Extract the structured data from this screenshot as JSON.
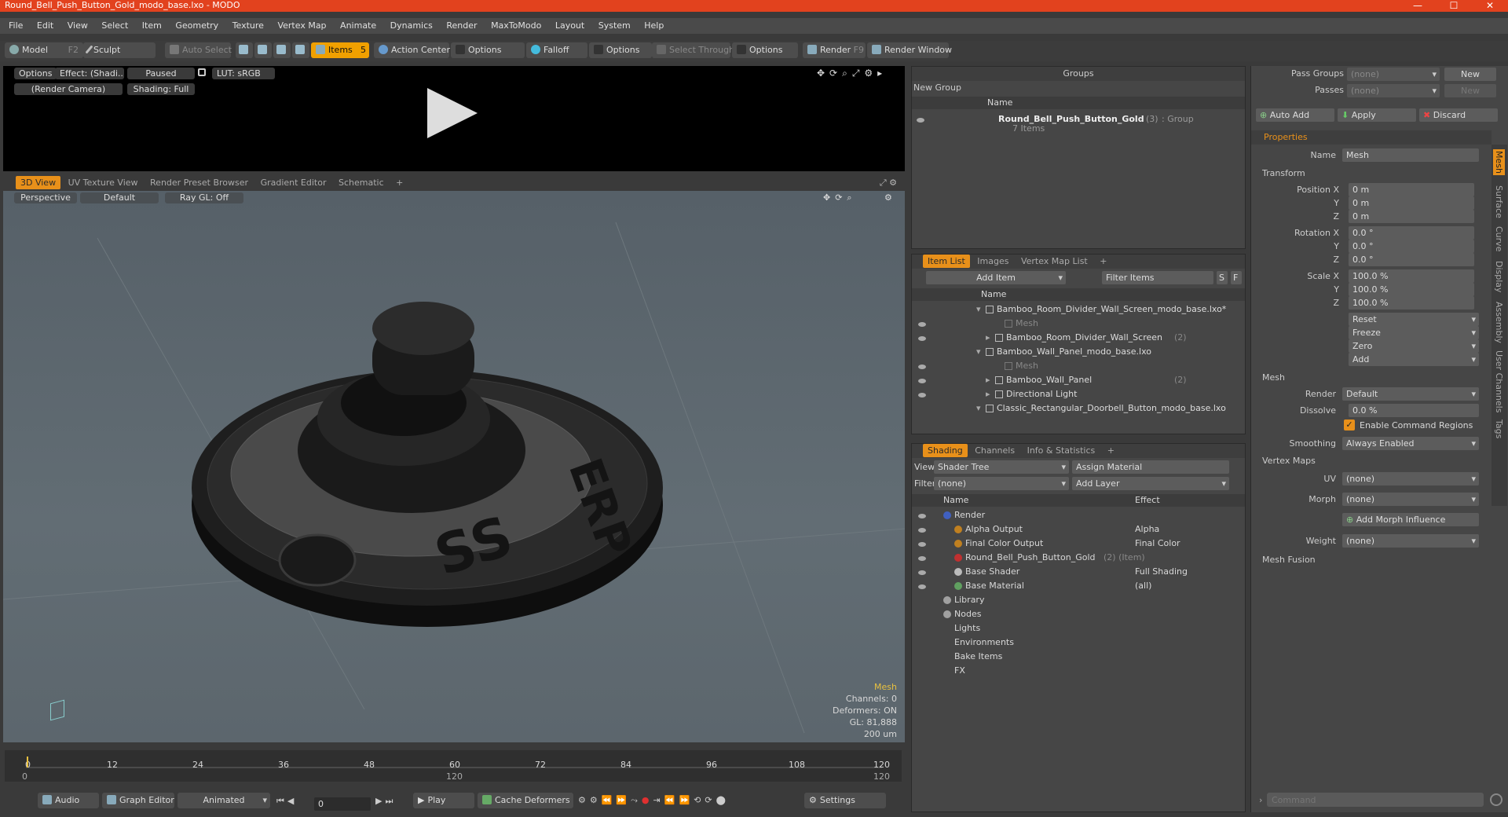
{
  "window": {
    "title": "Round_Bell_Push_Button_Gold_modo_base.lxo - MODO",
    "btn_min": "—",
    "btn_max": "☐",
    "btn_close": "✕"
  },
  "menu": [
    "File",
    "Edit",
    "View",
    "Select",
    "Item",
    "Geometry",
    "Texture",
    "Vertex Map",
    "Animate",
    "Dynamics",
    "Render",
    "MaxToModo",
    "Layout",
    "System",
    "Help"
  ],
  "toolbar": {
    "model": "Model",
    "model_key": "F2",
    "sculpt": "Sculpt",
    "auto_select": "Auto Select",
    "items": "Items",
    "items_key": "5",
    "action_center": "Action Center",
    "options1": "Options",
    "falloff": "Falloff",
    "options2": "Options",
    "select_through": "Select Through",
    "options3": "Options",
    "render": "Render",
    "render_key": "F9",
    "render_window": "Render Window"
  },
  "preview": {
    "options": "Options",
    "effect": "Effect: (Shadi...",
    "paused": "Paused",
    "lut": "LUT: sRGB",
    "camera": "(Render Camera)",
    "shading": "Shading: Full"
  },
  "viewport_tabs": [
    "3D View",
    "UV Texture View",
    "Render Preset Browser",
    "Gradient Editor",
    "Schematic",
    "+"
  ],
  "viewport": {
    "perspective": "Perspective",
    "default": "Default",
    "raygl": "Ray GL: Off",
    "info_title": "Mesh",
    "channels": "Channels: 0",
    "deformers": "Deformers: ON",
    "gl": "GL: 81,888",
    "scale": "200 um"
  },
  "timeline": {
    "ticks": [
      "0",
      "12",
      "24",
      "36",
      "48",
      "60",
      "72",
      "84",
      "96",
      "108",
      "120"
    ],
    "sub_left": "0",
    "sub_mid": "120",
    "sub_right": "120"
  },
  "bottombar": {
    "audio": "Audio",
    "graph_editor": "Graph Editor",
    "animated": "Animated",
    "frame": "0",
    "play": "Play",
    "cache": "Cache Deformers",
    "settings": "Settings"
  },
  "groups": {
    "title": "Groups",
    "new_group": "New Group",
    "col_name": "Name",
    "item_name": "Round_Bell_Push_Button_Gold",
    "item_count": "(3)",
    "item_type": ": Group",
    "item_sub": "7 Items"
  },
  "itemlist": {
    "tabs": [
      "Item List",
      "Images",
      "Vertex Map List",
      "+"
    ],
    "add_item": "Add Item",
    "filter": "Filter Items",
    "s": "S",
    "f": "F",
    "col_name": "Name",
    "rows": [
      {
        "label": "Bamboo_Room_Divider_Wall_Screen_modo_base.lxo*",
        "indent": 0,
        "dim": false
      },
      {
        "label": "Mesh",
        "indent": 2,
        "dim": true
      },
      {
        "label": "Bamboo_Room_Divider_Wall_Screen",
        "count": "(2)",
        "indent": 1,
        "dim": false
      },
      {
        "label": "Bamboo_Wall_Panel_modo_base.lxo",
        "indent": 0,
        "dim": false
      },
      {
        "label": "Mesh",
        "indent": 2,
        "dim": true
      },
      {
        "label": "Bamboo_Wall_Panel",
        "count": "(2)",
        "indent": 1,
        "dim": false
      },
      {
        "label": "Directional Light",
        "indent": 1,
        "dim": false
      },
      {
        "label": "Classic_Rectangular_Doorbell_Button_modo_base.lxo",
        "indent": 0,
        "dim": false
      }
    ]
  },
  "shading": {
    "tabs": [
      "Shading",
      "Channels",
      "Info & Statistics",
      "+"
    ],
    "view_label": "View",
    "view_value": "Shader Tree",
    "assign": "Assign Material",
    "filter_label": "Filter",
    "filter_value": "(none)",
    "add_layer": "Add Layer",
    "col_name": "Name",
    "col_effect": "Effect",
    "rows": [
      {
        "name": "Render",
        "effect": "",
        "indent": 0
      },
      {
        "name": "Alpha Output",
        "effect": "Alpha",
        "indent": 1
      },
      {
        "name": "Final Color Output",
        "effect": "Final Color",
        "indent": 1
      },
      {
        "name": "Round_Bell_Push_Button_Gold",
        "extra": "(2) (Item)",
        "effect": "",
        "indent": 1
      },
      {
        "name": "Base Shader",
        "effect": "Full Shading",
        "indent": 1
      },
      {
        "name": "Base Material",
        "effect": "(all)",
        "indent": 1
      },
      {
        "name": "Library",
        "effect": "",
        "indent": 0
      },
      {
        "name": "Nodes",
        "effect": "",
        "indent": 0
      },
      {
        "name": "Lights",
        "effect": "",
        "indent": 0
      },
      {
        "name": "Environments",
        "effect": "",
        "indent": 0
      },
      {
        "name": "Bake Items",
        "effect": "",
        "indent": 0
      },
      {
        "name": "FX",
        "effect": "",
        "indent": 0
      }
    ]
  },
  "props": {
    "pass_groups": "Pass Groups",
    "passes": "Passes",
    "none": "(none)",
    "new": "New",
    "auto_add": "Auto Add",
    "apply": "Apply",
    "discard": "Discard",
    "tab": "Properties",
    "name_label": "Name",
    "name_value": "Mesh",
    "transform": "Transform",
    "position_x": "Position X",
    "y": "Y",
    "z": "Z",
    "rotation_x": "Rotation X",
    "scale_x": "Scale X",
    "pos": [
      "0 m",
      "0 m",
      "0 m"
    ],
    "rot": [
      "0.0 °",
      "0.0 °",
      "0.0 °"
    ],
    "scl": [
      "100.0 %",
      "100.0 %",
      "100.0 %"
    ],
    "reset": "Reset",
    "freeze": "Freeze",
    "zero": "Zero",
    "add": "Add",
    "mesh": "Mesh",
    "render_label": "Render",
    "render_value": "Default",
    "dissolve_label": "Dissolve",
    "dissolve_value": "0.0 %",
    "enable_cmd": "Enable Command Regions",
    "smoothing_label": "Smoothing",
    "smoothing_value": "Always Enabled",
    "vertex_maps": "Vertex Maps",
    "uv_label": "UV",
    "uv_value": "(none)",
    "morph_label": "Morph",
    "morph_value": "(none)",
    "add_morph": "Add Morph Influence",
    "weight_label": "Weight",
    "weight_value": "(none)",
    "mesh_fusion": "Mesh Fusion",
    "side_tabs": [
      "Mesh",
      "Surface",
      "Curve",
      "Display",
      "Assembly",
      "User Channels",
      "Tags"
    ],
    "command_placeholder": "Command"
  }
}
